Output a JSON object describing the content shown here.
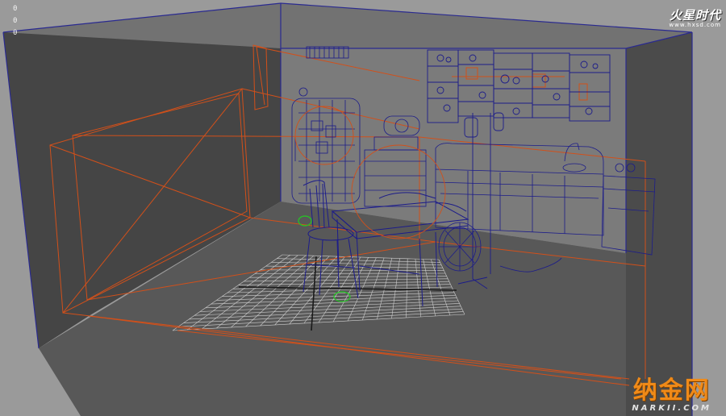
{
  "viewport": {
    "axis_indicators": [
      "0",
      "0",
      "0"
    ]
  },
  "watermarks": {
    "top_logo_name": "火星时代",
    "top_logo_url": "www.hxsd.com",
    "bottom_logo_name": "纳金网",
    "bottom_logo_url": "NARKII.COM"
  },
  "colors": {
    "background": "#9a9a9a",
    "wall_dark": "#4a4a4a",
    "floor": "#5a5a5a",
    "back_wall": "#7a7a7a",
    "wireframe": "#1c1c8a",
    "camera_lines": "#d2501a",
    "grid": "#cfcfcf",
    "selection_green": "#23c823",
    "room_edge": "#2a2a90"
  }
}
